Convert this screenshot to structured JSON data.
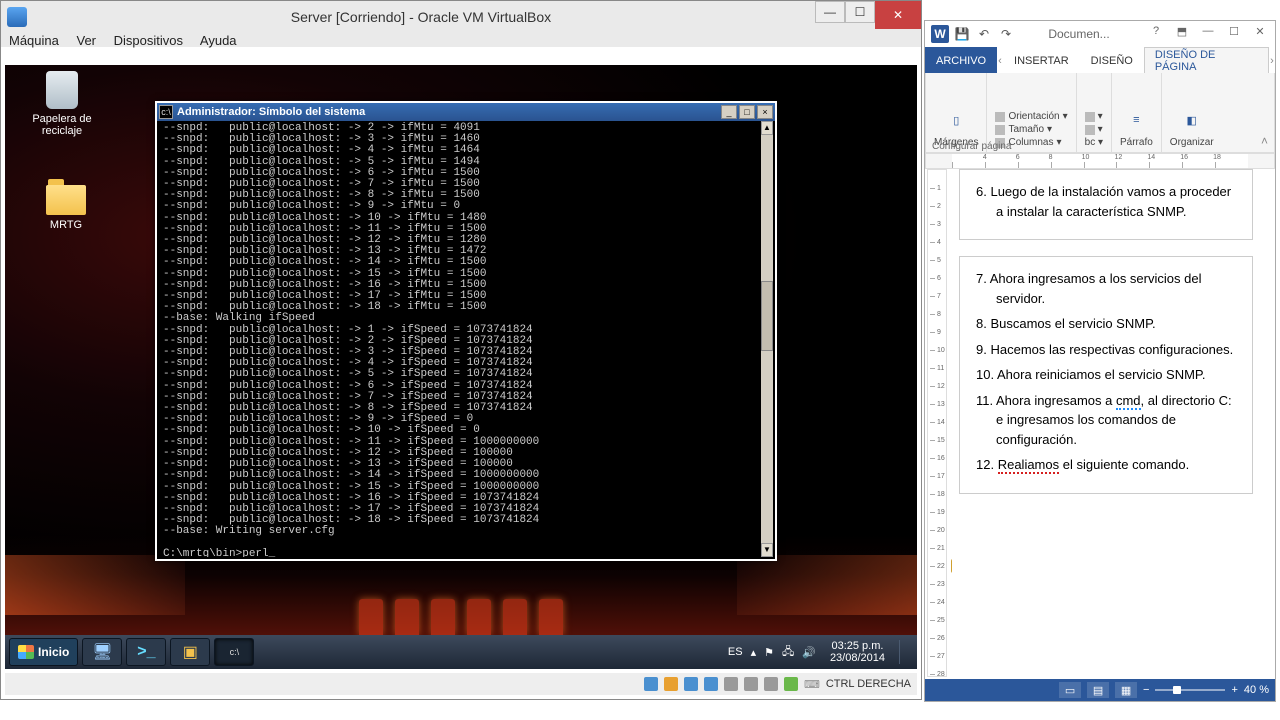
{
  "vbox": {
    "title": "Server [Corriendo] - Oracle VM VirtualBox",
    "menu": [
      "Máquina",
      "Ver",
      "Dispositivos",
      "Ayuda"
    ],
    "status_key": "CTRL DERECHA"
  },
  "desktop_icons": {
    "trash": "Papelera de reciclaje",
    "folder": "MRTG"
  },
  "cmd": {
    "title": "Administrador: Símbolo del sistema",
    "lines": [
      "--snpd:   public@localhost: -> 2 -> ifMtu = 4091",
      "--snpd:   public@localhost: -> 3 -> ifMtu = 1460",
      "--snpd:   public@localhost: -> 4 -> ifMtu = 1464",
      "--snpd:   public@localhost: -> 5 -> ifMtu = 1494",
      "--snpd:   public@localhost: -> 6 -> ifMtu = 1500",
      "--snpd:   public@localhost: -> 7 -> ifMtu = 1500",
      "--snpd:   public@localhost: -> 8 -> ifMtu = 1500",
      "--snpd:   public@localhost: -> 9 -> ifMtu = 0",
      "--snpd:   public@localhost: -> 10 -> ifMtu = 1480",
      "--snpd:   public@localhost: -> 11 -> ifMtu = 1500",
      "--snpd:   public@localhost: -> 12 -> ifMtu = 1280",
      "--snpd:   public@localhost: -> 13 -> ifMtu = 1472",
      "--snpd:   public@localhost: -> 14 -> ifMtu = 1500",
      "--snpd:   public@localhost: -> 15 -> ifMtu = 1500",
      "--snpd:   public@localhost: -> 16 -> ifMtu = 1500",
      "--snpd:   public@localhost: -> 17 -> ifMtu = 1500",
      "--snpd:   public@localhost: -> 18 -> ifMtu = 1500",
      "--base: Walking ifSpeed",
      "--snpd:   public@localhost: -> 1 -> ifSpeed = 1073741824",
      "--snpd:   public@localhost: -> 2 -> ifSpeed = 1073741824",
      "--snpd:   public@localhost: -> 3 -> ifSpeed = 1073741824",
      "--snpd:   public@localhost: -> 4 -> ifSpeed = 1073741824",
      "--snpd:   public@localhost: -> 5 -> ifSpeed = 1073741824",
      "--snpd:   public@localhost: -> 6 -> ifSpeed = 1073741824",
      "--snpd:   public@localhost: -> 7 -> ifSpeed = 1073741824",
      "--snpd:   public@localhost: -> 8 -> ifSpeed = 1073741824",
      "--snpd:   public@localhost: -> 9 -> ifSpeed = 0",
      "--snpd:   public@localhost: -> 10 -> ifSpeed = 0",
      "--snpd:   public@localhost: -> 11 -> ifSpeed = 1000000000",
      "--snpd:   public@localhost: -> 12 -> ifSpeed = 100000",
      "--snpd:   public@localhost: -> 13 -> ifSpeed = 100000",
      "--snpd:   public@localhost: -> 14 -> ifSpeed = 1000000000",
      "--snpd:   public@localhost: -> 15 -> ifSpeed = 1000000000",
      "--snpd:   public@localhost: -> 16 -> ifSpeed = 1073741824",
      "--snpd:   public@localhost: -> 17 -> ifSpeed = 1073741824",
      "--snpd:   public@localhost: -> 18 -> ifSpeed = 1073741824",
      "--base: Writing server.cfg",
      "",
      "C:\\mrtg\\bin>perl_"
    ]
  },
  "taskbar": {
    "start": "Inicio",
    "lang": "ES",
    "time": "03:25 p.m.",
    "date": "23/08/2014"
  },
  "word": {
    "title": "Documen...",
    "tabs": {
      "file": "ARCHIVO",
      "insert": "INSERTAR",
      "design": "DISEÑO",
      "layout": "DISEÑO DE PÁGINA"
    },
    "ribbon": {
      "margins": "Márgenes",
      "orientation": "Orientación",
      "size": "Tamaño",
      "columns": "Columnas",
      "paragraph": "Párrafo",
      "organize": "Organizar",
      "sub_label": "Configurar página"
    },
    "ruler_ticks": [
      "",
      "4",
      "6",
      "8",
      "10",
      "12",
      "14",
      "16",
      "18"
    ],
    "doc": {
      "item6": {
        "n": "6.",
        "text": "Luego de la instalación vamos a proceder a instalar la característica SNMP."
      },
      "item7": {
        "n": "7.",
        "text": "Ahora ingresamos a los servicios del servidor."
      },
      "item8": {
        "n": "8.",
        "text": "Buscamos el servicio SNMP."
      },
      "item9": {
        "n": "9.",
        "text": "Hacemos las respectivas configuraciones."
      },
      "item10": {
        "n": "10.",
        "text": "Ahora reiniciamos el servicio SNMP."
      },
      "item11": {
        "n": "11.",
        "pre": "Ahora ingresamos a ",
        "cmd": "cmd",
        "post": ", al directorio C: e ingresamos los comandos de configuración."
      },
      "item12": {
        "n": "12.",
        "err": "Realiamos",
        "post": " el siguiente comando."
      }
    },
    "zoom": "40 %"
  }
}
